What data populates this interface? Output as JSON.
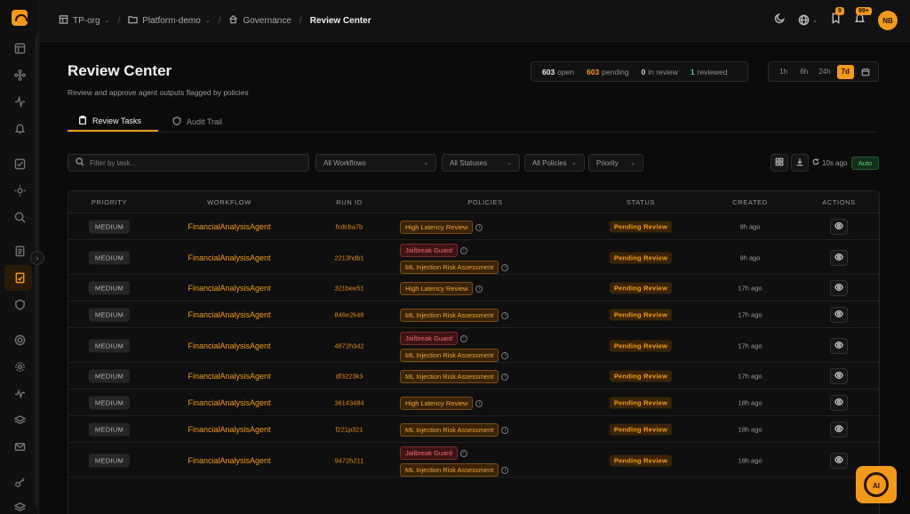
{
  "breadcrumb": {
    "org": "TP-org",
    "project": "Platform-demo",
    "section": "Governance",
    "current": "Review Center",
    "separator": "/"
  },
  "header": {
    "title": "Review Center",
    "subtitle": "Review and approve agent outputs flagged by policies"
  },
  "topbar": {
    "bookmark_badge": "9",
    "notification_badge": "99+",
    "avatar_initials": "NB"
  },
  "stats": {
    "open_count": "603",
    "open_label": "open",
    "pending_count": "603",
    "pending_label": "pending",
    "in_review_count": "0",
    "in_review_label": "in review",
    "reviewed_count": "1",
    "reviewed_label": "reviewed"
  },
  "time_range": {
    "options": [
      "1h",
      "6h",
      "24h",
      "7d"
    ],
    "selected": "7d"
  },
  "tabs": [
    {
      "label": "Review Tasks",
      "active": true
    },
    {
      "label": "Audit Trail",
      "active": false
    }
  ],
  "filters": {
    "search_placeholder": "Filter by task...",
    "workflow": "All Workflows",
    "status": "All Statuses",
    "policy": "All Policies",
    "priority": "Priority",
    "last_refresh": "10s ago",
    "auto_label": "Auto"
  },
  "table": {
    "columns": [
      "PRIORITY",
      "WORKFLOW",
      "RUN ID",
      "POLICIES",
      "STATUS",
      "CREATED",
      "ACTIONS"
    ],
    "rows": [
      {
        "priority": "MEDIUM",
        "workflow": "FinancialAnalysisAgent",
        "run_id": "fcdcba7b",
        "policies": [
          "High Latency Review"
        ],
        "status": "Pending Review",
        "created": "9h ago"
      },
      {
        "priority": "MEDIUM",
        "workflow": "FinancialAnalysisAgent",
        "run_id": "2213hdb1",
        "policies": [
          "Jailbreak Guard",
          "ML Injection Risk Assessment"
        ],
        "status": "Pending Review",
        "created": "9h ago"
      },
      {
        "priority": "MEDIUM",
        "workflow": "FinancialAnalysisAgent",
        "run_id": "321bee51",
        "policies": [
          "High Latency Review"
        ],
        "status": "Pending Review",
        "created": "17h ago"
      },
      {
        "priority": "MEDIUM",
        "workflow": "FinancialAnalysisAgent",
        "run_id": "846e2k48",
        "policies": [
          "ML Injection Risk Assessment"
        ],
        "status": "Pending Review",
        "created": "17h ago"
      },
      {
        "priority": "MEDIUM",
        "workflow": "FinancialAnalysisAgent",
        "run_id": "4872h342",
        "policies": [
          "Jailbreak Guard",
          "ML Injection Risk Assessment"
        ],
        "status": "Pending Review",
        "created": "17h ago"
      },
      {
        "priority": "MEDIUM",
        "workflow": "FinancialAnalysisAgent",
        "run_id": "df3223k3",
        "policies": [
          "ML Injection Risk Assessment"
        ],
        "status": "Pending Review",
        "created": "17h ago"
      },
      {
        "priority": "MEDIUM",
        "workflow": "FinancialAnalysisAgent",
        "run_id": "36143484",
        "policies": [
          "High Latency Review"
        ],
        "status": "Pending Review",
        "created": "18h ago"
      },
      {
        "priority": "MEDIUM",
        "workflow": "FinancialAnalysisAgent",
        "run_id": "f221p321",
        "policies": [
          "ML Injection Risk Assessment"
        ],
        "status": "Pending Review",
        "created": "18h ago"
      },
      {
        "priority": "MEDIUM",
        "workflow": "FinancialAnalysisAgent",
        "run_id": "9472h211",
        "policies": [
          "Jailbreak Guard",
          "ML Injection Risk Assessment"
        ],
        "status": "Pending Review",
        "created": "18h ago"
      }
    ]
  },
  "assistant": {
    "label": "AI"
  },
  "colors": {
    "accent": "#f39a1c",
    "background": "#0b0b0b",
    "success": "#5fcf72",
    "danger": "#f06a6a"
  }
}
